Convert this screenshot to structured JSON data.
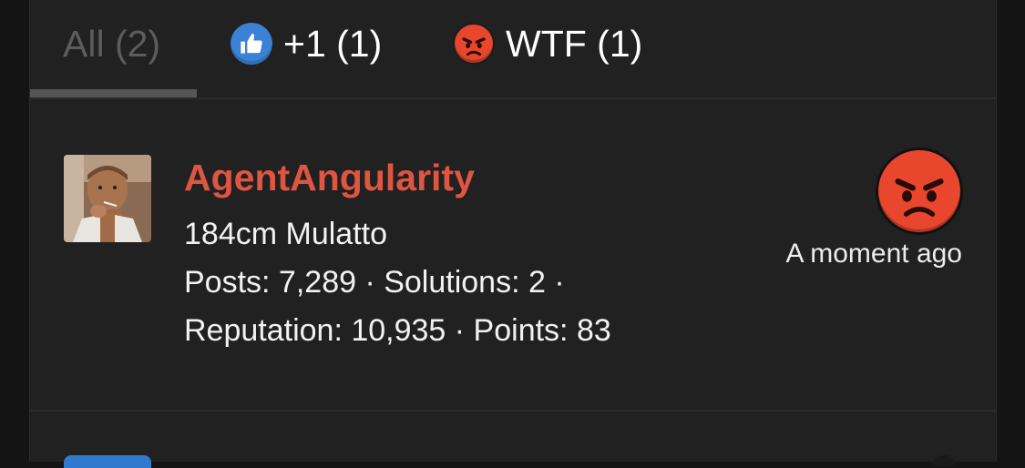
{
  "colors": {
    "username": "#de5542",
    "like_badge": "#3b82d6",
    "angry_face": "#e8472e",
    "panel_bg": "#212121"
  },
  "tabs": [
    {
      "label": "All (2)",
      "icon": null,
      "active": true
    },
    {
      "label": "+1 (1)",
      "icon": "thumbs-up-icon"
    },
    {
      "label": "WTF (1)",
      "icon": "angry-face-icon"
    }
  ],
  "reaction": {
    "user": {
      "name": "AgentAngularity",
      "title": "184cm Mulatto",
      "stats_line1": "Posts: 7,289 · Solutions: 2 ·",
      "stats_line2": "Reputation: 10,935 · Points: 83",
      "avatar": "user-avatar-photo"
    },
    "reaction_icon": "angry-face-icon",
    "timestamp": "A moment ago"
  }
}
